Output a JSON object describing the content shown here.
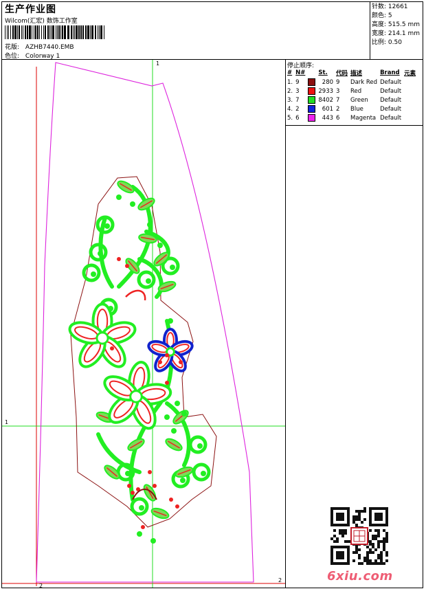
{
  "header": {
    "title": "生产作业图",
    "company": "Wilcom(汇宏) 数饰工作室",
    "design_label": "花版:",
    "design_value": "AZHB7440.EMB",
    "colorway_label": "色位:",
    "colorway_value": "Colorway 1"
  },
  "stats": {
    "stitches": "针数: 12661",
    "colors": "颜色: 5",
    "height": "高度: 515.5 mm",
    "width": "宽度: 214.1 mm",
    "scale": "比例: 0.50"
  },
  "sequence": {
    "title": "停止顺序:",
    "columns": [
      "#",
      "N#",
      "St.",
      "代码",
      "描述",
      "Brand",
      "元素"
    ],
    "rows": [
      {
        "idx": "1.",
        "n": "9",
        "color": "#8b1010",
        "st": "280",
        "code": "9",
        "desc": "Dark Red",
        "brand": "Default"
      },
      {
        "idx": "2.",
        "n": "3",
        "color": "#ee1111",
        "st": "2933",
        "code": "3",
        "desc": "Red",
        "brand": "Default"
      },
      {
        "idx": "3.",
        "n": "7",
        "color": "#22dd22",
        "st": "8402",
        "code": "7",
        "desc": "Green",
        "brand": "Default"
      },
      {
        "idx": "4.",
        "n": "2",
        "color": "#1122dd",
        "st": "601",
        "code": "2",
        "desc": "Blue",
        "brand": "Default"
      },
      {
        "idx": "5.",
        "n": "6",
        "color": "#ee22ee",
        "st": "443",
        "code": "6",
        "desc": "Magenta",
        "brand": "Default"
      }
    ]
  },
  "canvas": {
    "axis_top_label": "1",
    "axis_left_label": "1",
    "axis_bottom_label": "2",
    "axis_right_label": "2"
  },
  "watermark": "6xiu.com",
  "icons": {
    "qr": "qr-code-icon",
    "seal": "seal-stamp-icon"
  }
}
